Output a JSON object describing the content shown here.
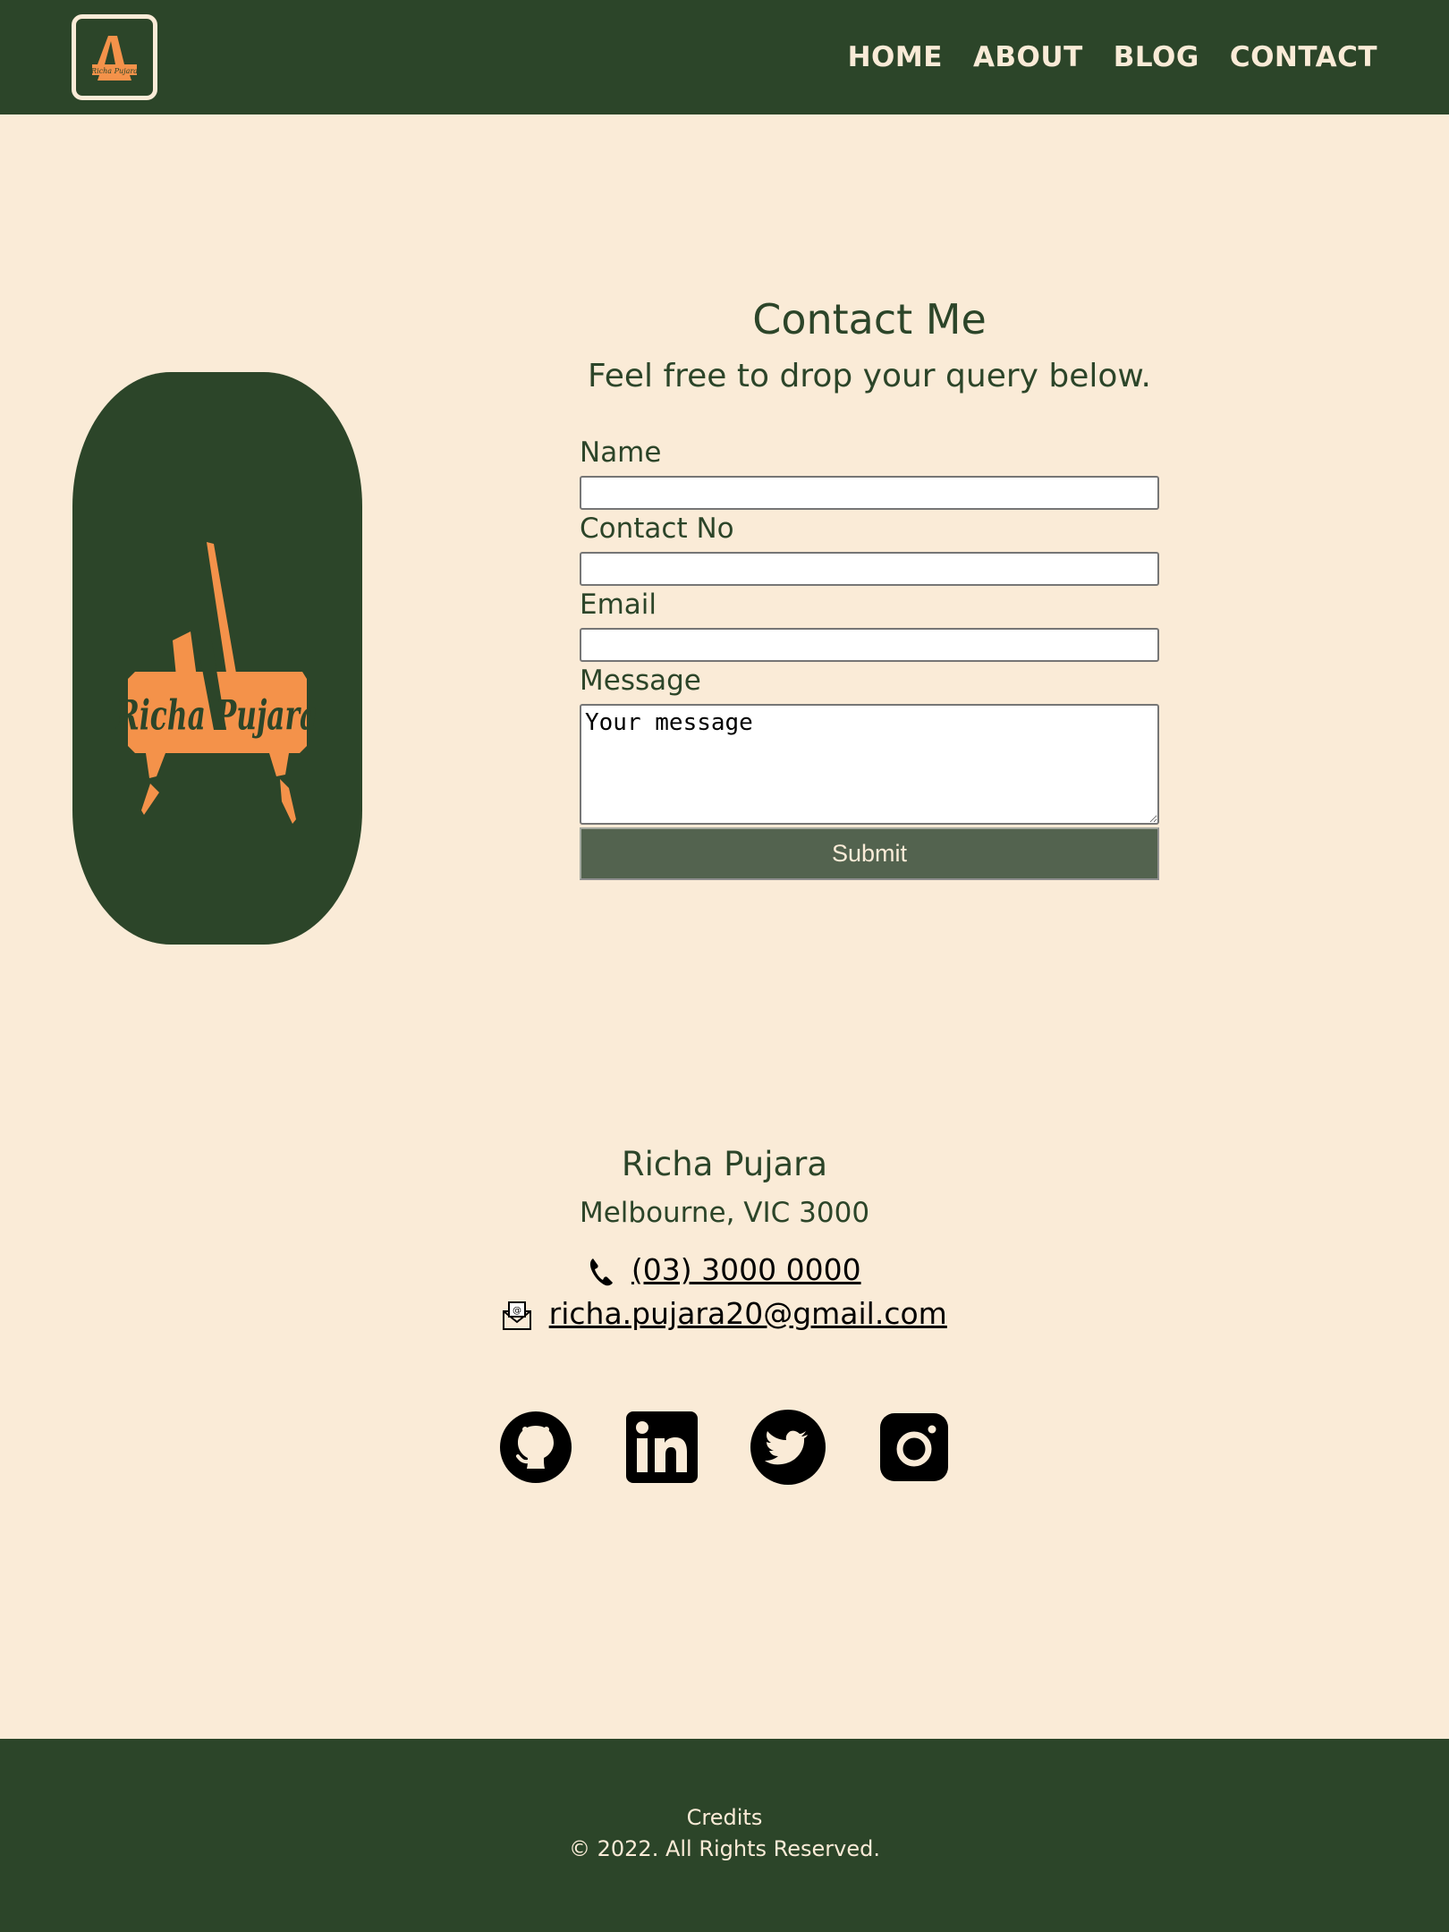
{
  "brand": {
    "logo_text": "Richa Pujara",
    "logo_color": "#f4924a",
    "dark_green": "#2c4529",
    "cream": "#faebd7"
  },
  "nav": {
    "items": [
      {
        "label": "HOME"
      },
      {
        "label": "ABOUT"
      },
      {
        "label": "BLOG"
      },
      {
        "label": "CONTACT"
      }
    ]
  },
  "contact": {
    "title": "Contact Me",
    "subtitle": "Feel free to drop your query below.",
    "fields": {
      "name_label": "Name",
      "phone_label": "Contact No",
      "email_label": "Email",
      "message_label": "Message",
      "message_placeholder": "Your message"
    },
    "submit_label": "Submit",
    "submit_color": "#53634f"
  },
  "footer_info": {
    "name": "Richa Pujara",
    "location": "Melbourne, VIC 3000",
    "phone": "(03) 3000 0000",
    "email": "richa.pujara20@gmail.com",
    "phone_icon": "phone-icon",
    "email_icon": "envelope-icon"
  },
  "social": [
    {
      "icon": "github-icon"
    },
    {
      "icon": "linkedin-icon"
    },
    {
      "icon": "twitter-icon"
    },
    {
      "icon": "instagram-icon"
    }
  ],
  "site_footer": {
    "credits": "Credits",
    "copyright": "© 2022. All Rights Reserved."
  }
}
